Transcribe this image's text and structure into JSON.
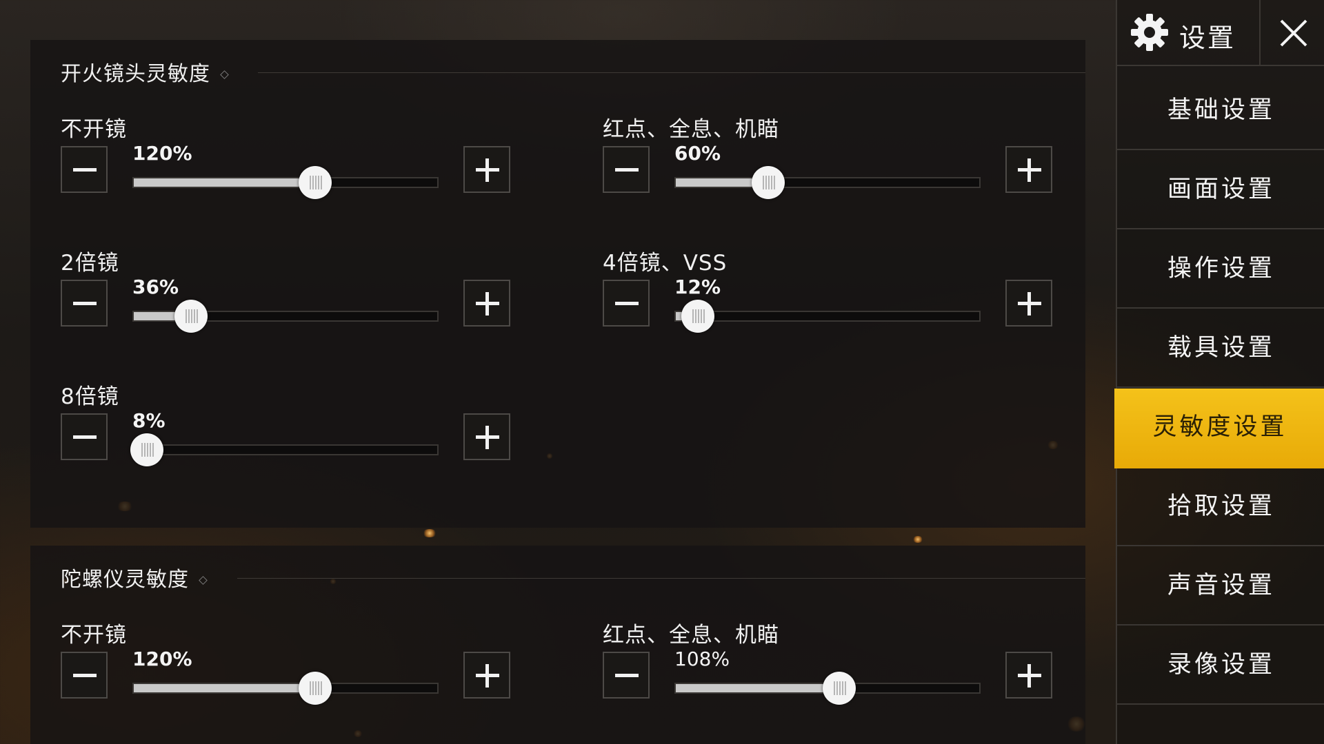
{
  "sections": [
    {
      "title": "开火镜头灵敏度",
      "rows": [
        {
          "label": "不开镜",
          "value": "120%",
          "fraction": 0.6
        },
        {
          "label": "红点、全息、机瞄",
          "value": "60%",
          "fraction": 0.3
        },
        {
          "label": "2倍镜",
          "value": "36%",
          "fraction": 0.18
        },
        {
          "label": "4倍镜、VSS",
          "value": "12%",
          "fraction": 0.06
        },
        {
          "label": "8倍镜",
          "value": "8%",
          "fraction": 0.03
        }
      ]
    },
    {
      "title": "陀螺仪灵敏度",
      "rows": [
        {
          "label": "不开镜",
          "value": "120%",
          "fraction": 0.6
        },
        {
          "label": "红点、全息、机瞄",
          "value": "108%",
          "fraction": 0.54
        }
      ]
    }
  ],
  "sidebar": {
    "title": "设置",
    "gear_icon": "gear-icon",
    "close_icon": "close-icon",
    "items": [
      {
        "label": "基础设置",
        "active": false
      },
      {
        "label": "画面设置",
        "active": false
      },
      {
        "label": "操作设置",
        "active": false
      },
      {
        "label": "载具设置",
        "active": false
      },
      {
        "label": "灵敏度设置",
        "active": true
      },
      {
        "label": "拾取设置",
        "active": false
      },
      {
        "label": "声音设置",
        "active": false
      },
      {
        "label": "录像设置",
        "active": false
      }
    ]
  },
  "colors": {
    "accent": "#f0b70f",
    "slider_fill": "#c9c9c9",
    "panel_bg": "#161413"
  }
}
